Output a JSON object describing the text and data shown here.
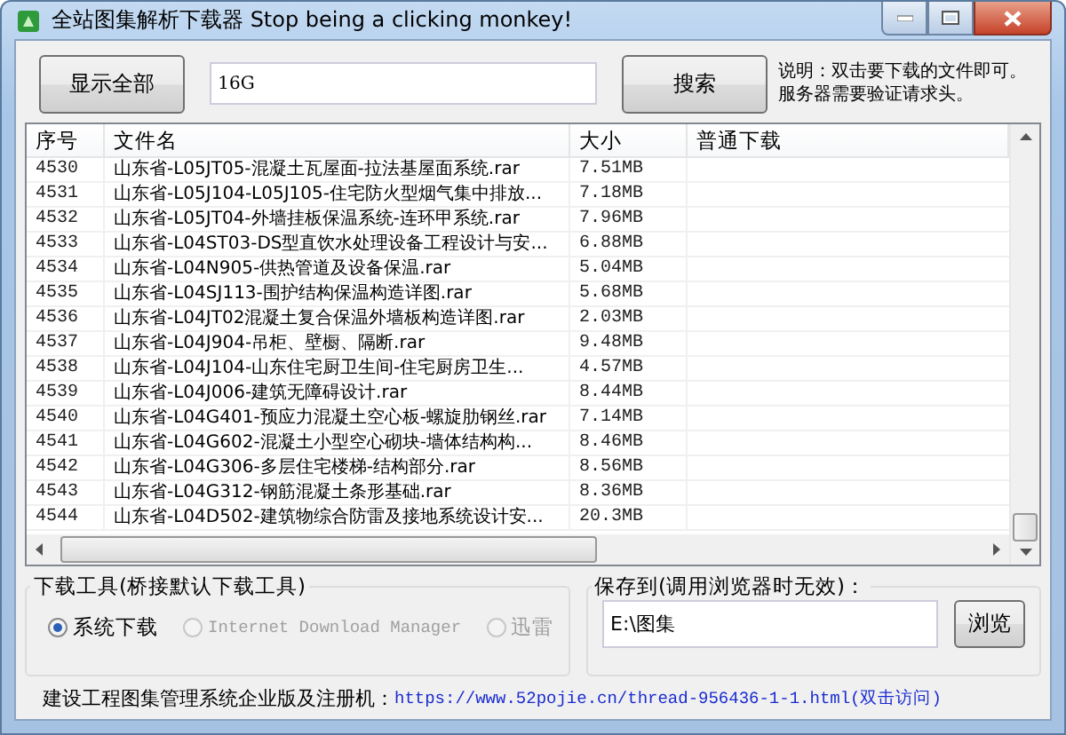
{
  "window": {
    "title": "全站图集解析下载器 Stop being a clicking monkey!"
  },
  "toolbar": {
    "show_all_button": "显示全部",
    "search_field": {
      "value": "16G"
    },
    "search_button": "搜索",
    "note": "说明：双击要下载的文件即可。服务器需要验证请求头。"
  },
  "table": {
    "columns": [
      "序号",
      "文件名",
      "大小",
      "普通下载"
    ],
    "rows": [
      {
        "cells": [
          "4530",
          "山东省-L05JT05-混凝土瓦屋面-拉法基屋面系统.rar",
          "7.51MB"
        ]
      },
      {
        "cells": [
          "4531",
          "山东省-L05J104-L05J105-住宅防火型烟气集中排放...",
          "7.18MB"
        ]
      },
      {
        "cells": [
          "4532",
          "山东省-L05JT04-外墙挂板保温系统-连环甲系统.rar",
          "7.96MB"
        ]
      },
      {
        "cells": [
          "4533",
          "山东省-L04ST03-DS型直饮水处理设备工程设计与安...",
          "6.88MB"
        ]
      },
      {
        "cells": [
          "4534",
          "山东省-L04N905-供热管道及设备保温.rar",
          "5.04MB"
        ]
      },
      {
        "cells": [
          "4535",
          "山东省-L04SJ113-围护结构保温构造详图.rar",
          "5.68MB"
        ]
      },
      {
        "cells": [
          "4536",
          "山东省-L04JT02混凝土复合保温外墙板构造详图.rar",
          "2.03MB"
        ]
      },
      {
        "cells": [
          "4537",
          "山东省-L04J904-吊柜、壁橱、隔断.rar",
          "9.48MB"
        ]
      },
      {
        "cells": [
          "4538",
          "山东省-L04J104-山东住宅厨卫生间-住宅厨房卫生...",
          "4.57MB"
        ]
      },
      {
        "cells": [
          "4539",
          "山东省-L04J006-建筑无障碍设计.rar",
          "8.44MB"
        ]
      },
      {
        "cells": [
          "4540",
          "山东省-L04G401-预应力混凝土空心板-螺旋肋钢丝.rar",
          "7.14MB"
        ]
      },
      {
        "cells": [
          "4541",
          "山东省-L04G602-混凝土小型空心砌块-墙体结构构...",
          "8.46MB"
        ]
      },
      {
        "cells": [
          "4542",
          "山东省-L04G306-多层住宅楼梯-结构部分.rar",
          "8.56MB"
        ]
      },
      {
        "cells": [
          "4543",
          "山东省-L04G312-钢筋混凝土条形基础.rar",
          "8.36MB"
        ]
      },
      {
        "cells": [
          "4544",
          "山东省-L04D502-建筑物综合防雷及接地系统设计安...",
          "20.3MB"
        ]
      }
    ]
  },
  "download_tool": {
    "title": "下载工具(桥接默认下载工具)",
    "options": [
      {
        "label": "系统下载",
        "selected": true,
        "disabled": false
      },
      {
        "label": "Internet Download Manager",
        "selected": false,
        "disabled": true
      },
      {
        "label": "迅雷",
        "selected": false,
        "disabled": true
      }
    ]
  },
  "save_to": {
    "title": "保存到(调用浏览器时无效)：",
    "path_field": {
      "value": "E:\\图集"
    },
    "browse_button": "浏览"
  },
  "footer": {
    "label": "建设工程图集管理系统企业版及注册机：",
    "link": "https://www.52pojie.cn/thread-956436-1-1.html(双击访问)"
  }
}
